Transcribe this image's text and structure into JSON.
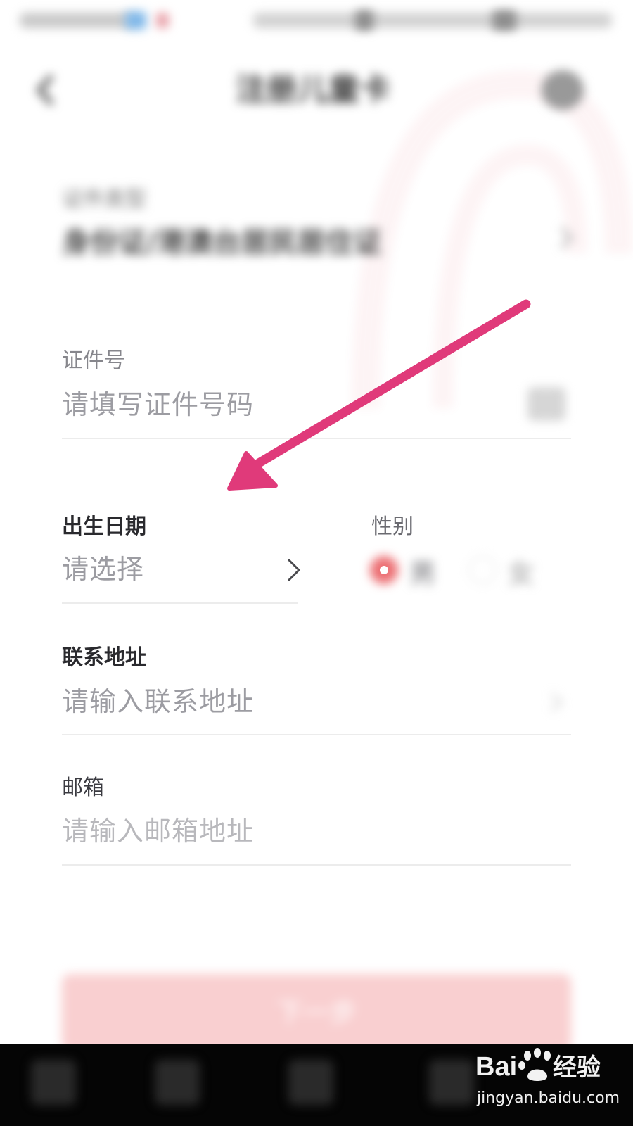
{
  "header": {
    "title": "注册儿童卡"
  },
  "form": {
    "doc_type": {
      "label": "证件类型",
      "value": "身份证/港澳台居民居住证"
    },
    "id_number": {
      "label": "证件号",
      "placeholder": "请填写证件号码"
    },
    "birth_date": {
      "label": "出生日期",
      "value": "请选择"
    },
    "gender": {
      "label": "性别",
      "options": [
        "男",
        "女"
      ],
      "selected": "男"
    },
    "address": {
      "label": "联系地址",
      "placeholder": "请输入联系地址"
    },
    "email": {
      "label": "邮箱",
      "placeholder": "请输入邮箱地址"
    },
    "submit_label": "下一步"
  },
  "watermark": {
    "logo_text": "Bai  经验",
    "url": "jingyan.baidu.com"
  },
  "colors": {
    "accent": "#ec6f73",
    "button": "#f9cfd0",
    "arrow": "#e03a7a"
  }
}
